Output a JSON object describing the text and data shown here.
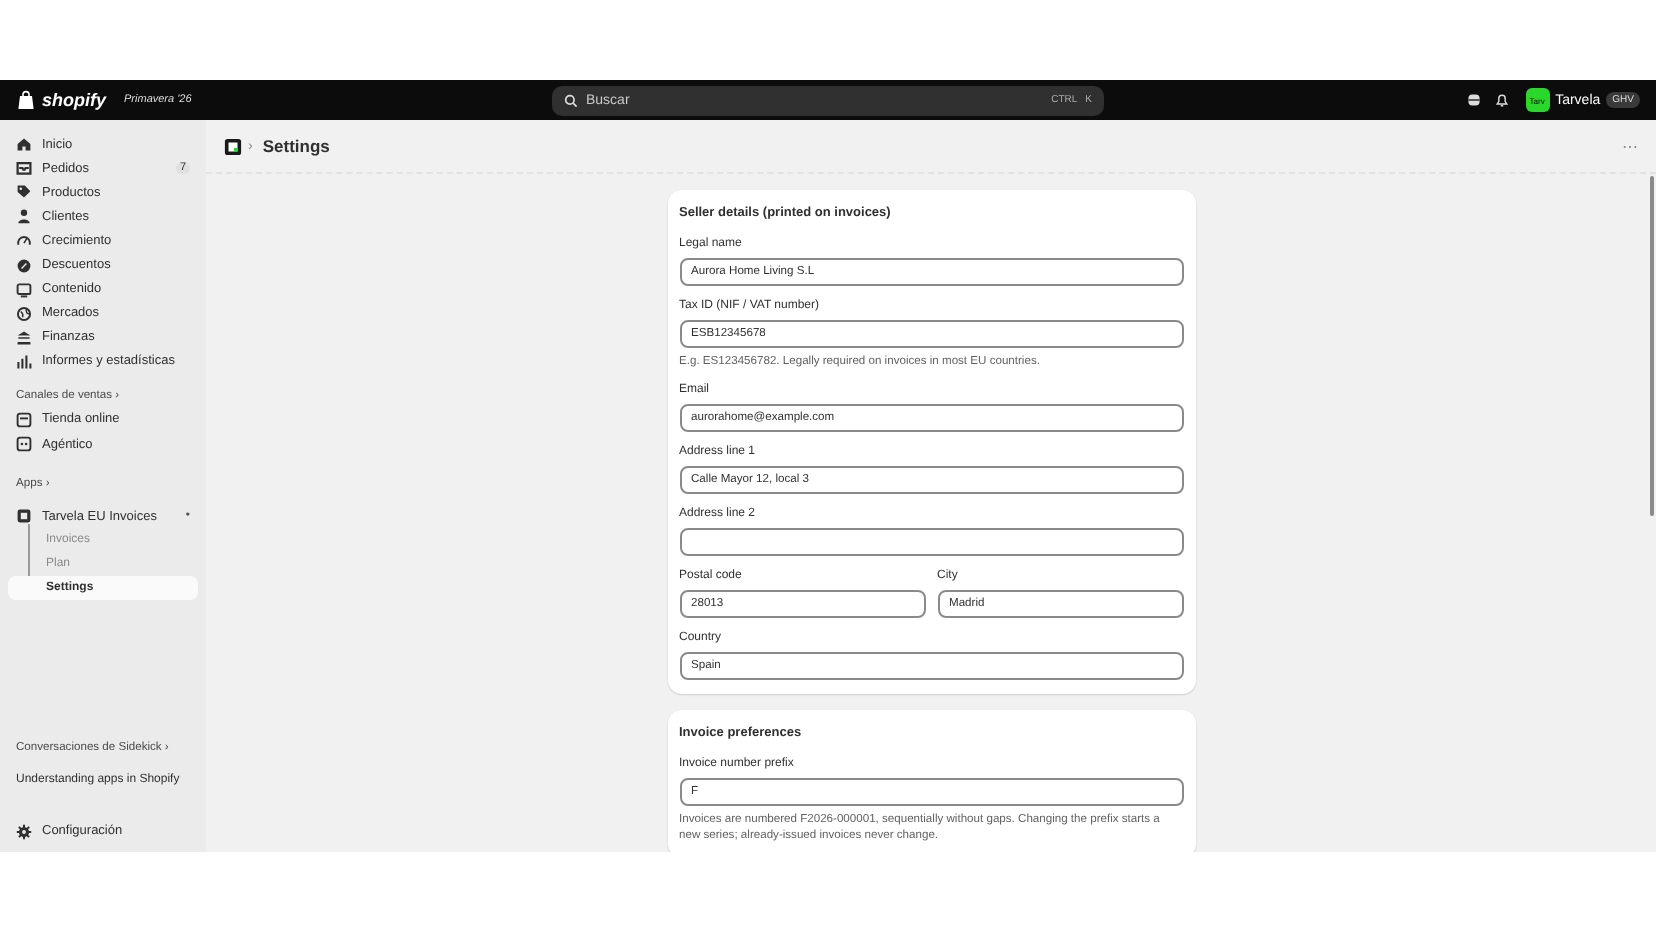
{
  "topbar": {
    "logo": "shopify",
    "edition": "Primavera '26",
    "search": {
      "placeholder": "Buscar",
      "shortcut": [
        "CTRL",
        "K"
      ]
    },
    "store": {
      "avatar": "Tarv",
      "name": "Tarvela",
      "badge": "GHV"
    }
  },
  "sidebar": {
    "items": [
      {
        "label": "Inicio",
        "selected": false
      },
      {
        "label": "Pedidos",
        "count": "7",
        "selected": false
      },
      {
        "label": "Productos",
        "selected": false
      },
      {
        "label": "Clientes",
        "selected": false
      },
      {
        "label": "Crecimiento",
        "selected": false
      },
      {
        "label": "Descuentos",
        "selected": false
      },
      {
        "label": "Contenido",
        "selected": false
      },
      {
        "label": "Mercados",
        "selected": false
      },
      {
        "label": "Finanzas",
        "selected": false
      },
      {
        "label": "Informes y estadísticas",
        "selected": false
      }
    ],
    "channels": {
      "heading": "Canales de ventas ›",
      "items": [
        {
          "label": "Tienda online",
          "selected": false
        },
        {
          "label": "Agéntico",
          "selected": false
        }
      ]
    },
    "apps": {
      "heading": "Apps ›",
      "app": {
        "label": "Tarvela EU Invoices",
        "marker": "•",
        "children": [
          {
            "label": "Invoices",
            "selected": false
          },
          {
            "label": "Plan",
            "selected": false
          },
          {
            "label": "Settings",
            "selected": true
          }
        ]
      }
    },
    "sidekick": {
      "heading": "Conversaciones de Sidekick ›",
      "items": [
        "Understanding apps in Shopify"
      ]
    },
    "footer": {
      "label": "Configuración"
    }
  },
  "page": {
    "breadcrumb_sep": "›",
    "title": "Settings",
    "menu": "⋯",
    "cards": [
      {
        "title": "Seller details (printed on invoices)",
        "rows": [
          [
            {
              "label": "Legal name",
              "value": "Aurora Home Living S.L"
            }
          ],
          [
            {
              "label": "Tax ID (NIF / VAT number)",
              "value": "ESB12345678",
              "help": "E.g. ES123456782. Legally required on invoices in most EU countries."
            }
          ],
          [
            {
              "label": "Email",
              "value": "aurorahome@example.com"
            }
          ],
          [
            {
              "label": "Address line 1",
              "value": "Calle Mayor 12, local 3"
            }
          ],
          [
            {
              "label": "Address line 2"
            }
          ],
          [
            {
              "label": "Postal code",
              "value": "28013"
            },
            {
              "label": "City",
              "value": "Madrid"
            }
          ],
          [
            {
              "label": "Country",
              "value": "Spain"
            }
          ]
        ]
      },
      {
        "title": "Invoice preferences",
        "rows": [
          [
            {
              "label": "Invoice number prefix",
              "value": "F",
              "help": "Invoices are numbered F2026-000001, sequentially without gaps. Changing the prefix starts a new series; already-issued invoices never change."
            }
          ]
        ]
      }
    ]
  }
}
